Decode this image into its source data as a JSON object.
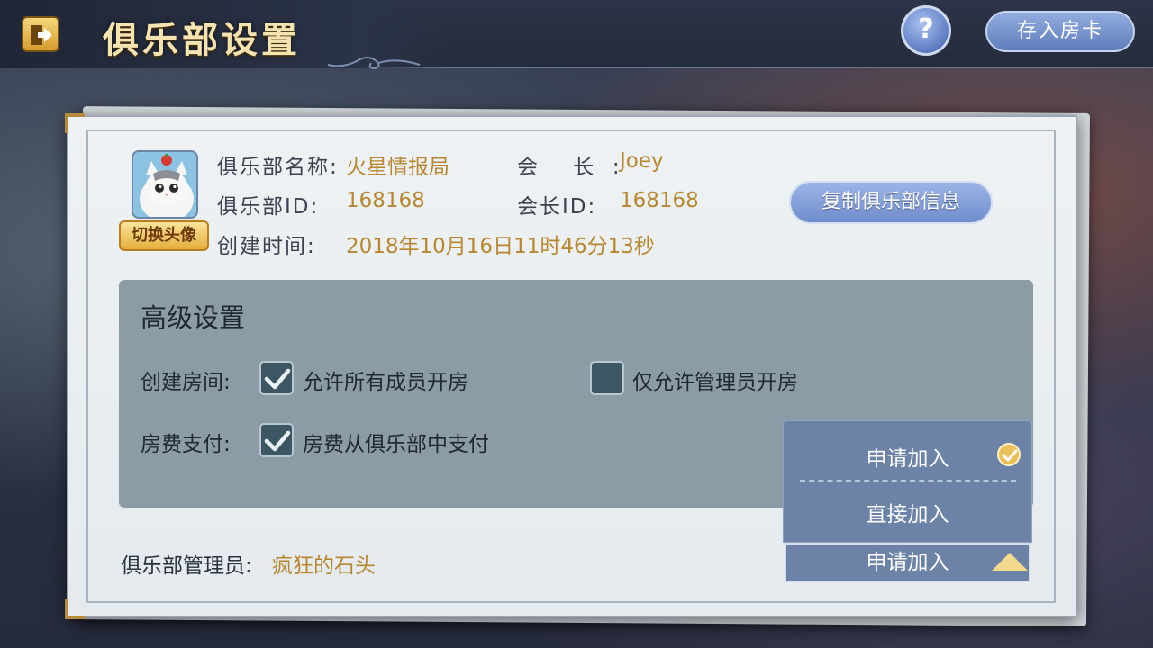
{
  "header": {
    "title": "俱乐部设置",
    "help_label": "?",
    "deposit_label": "存入房卡"
  },
  "club": {
    "switch_avatar_label": "切换头像",
    "name_label": "俱乐部名称:",
    "name_value": "火星情报局",
    "id_label": "俱乐部ID:",
    "id_value": "168168",
    "created_label": "创建时间:",
    "created_value": "2018年10月16日11时46分13秒",
    "owner_label": "会    长  :",
    "owner_value": "Joey",
    "owner_id_label": "会长ID:",
    "owner_id_value": "168168",
    "copy_button": "复制俱乐部信息"
  },
  "advanced": {
    "title": "高级设置",
    "create_room_label": "创建房间:",
    "option_all_members": "允许所有成员开房",
    "option_all_members_checked": true,
    "option_admin_only": "仅允许管理员开房",
    "option_admin_only_checked": false,
    "fee_label": "房费支付:",
    "option_fee_from_club": "房费从俱乐部中支付",
    "option_fee_from_club_checked": true
  },
  "join_mode": {
    "options": [
      "申请加入",
      "直接加入"
    ],
    "selected": "申请加入"
  },
  "admins": {
    "label": "俱乐部管理员:",
    "value": "疯狂的石头"
  },
  "colors": {
    "accent_gold": "#b8862e",
    "button_blue": "#6f8ccc",
    "settings_bg": "#8c9ca6"
  }
}
